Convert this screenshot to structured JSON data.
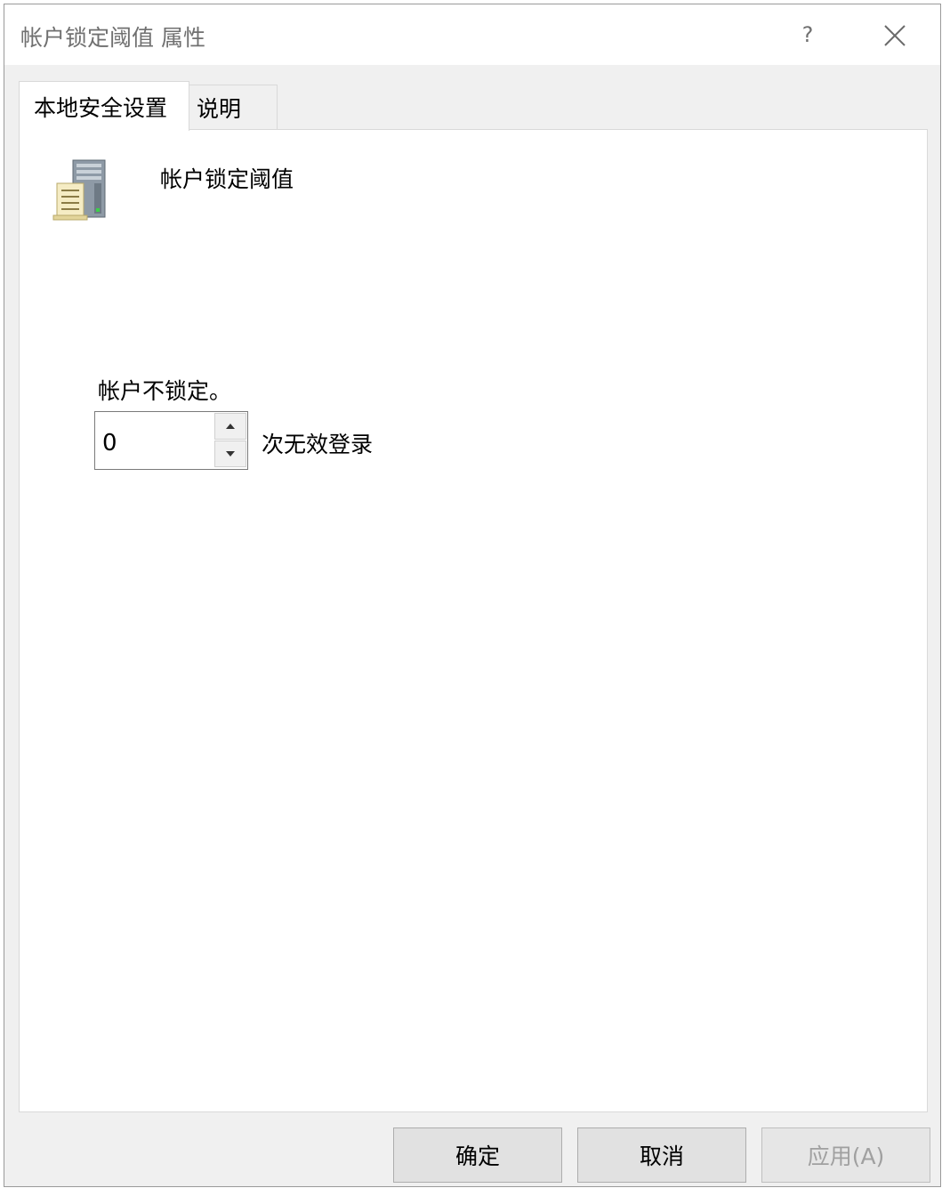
{
  "window": {
    "title": "帐户锁定阈值 属性",
    "help_label": "?"
  },
  "tabs": [
    {
      "label": "本地安全设置",
      "active": true
    },
    {
      "label": "说明",
      "active": false
    }
  ],
  "policy": {
    "icon": "server-policy-icon",
    "name": "帐户锁定阈值",
    "status": "帐户不锁定。",
    "threshold_value": "0",
    "unit_label": "次无效登录"
  },
  "buttons": {
    "ok": "确定",
    "cancel": "取消",
    "apply": "应用(A)",
    "apply_enabled": false
  },
  "colors": {
    "dialog_background": "#f0f0f0",
    "panel_background": "#ffffff",
    "disabled_text": "#a0a0a0"
  }
}
